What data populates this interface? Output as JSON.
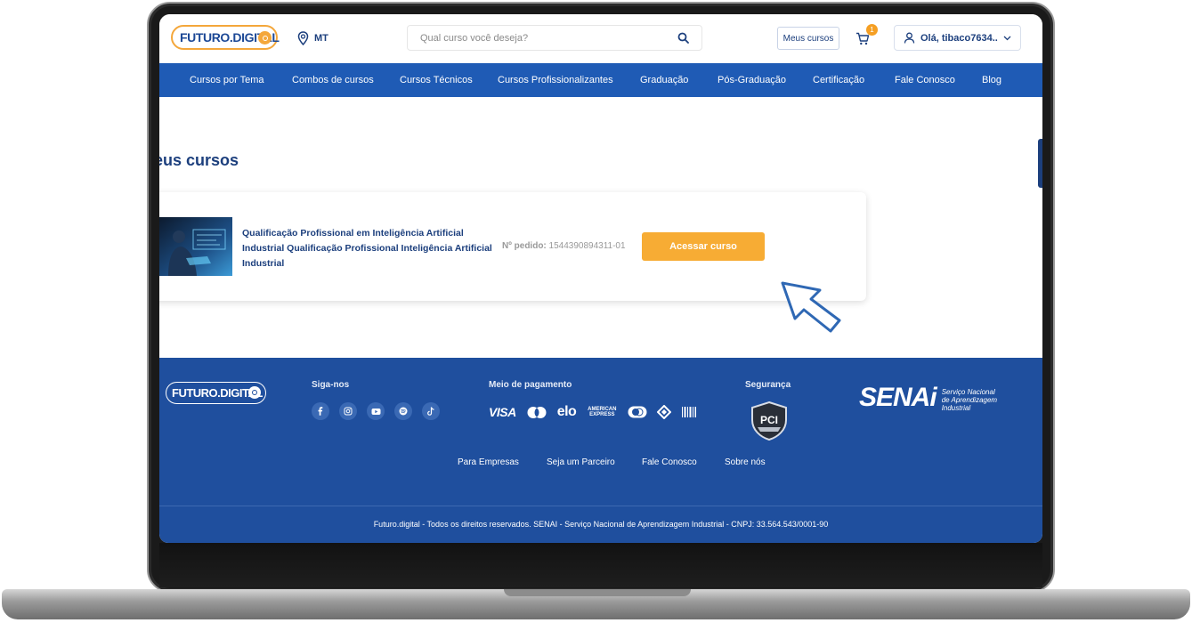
{
  "header": {
    "logo": "FUTURO.DIGITAL",
    "location": "MT",
    "search_placeholder": "Qual curso você deseja?",
    "my_courses_button": "Meus cursos",
    "cart_count": "1",
    "user_greeting": "Olá, tibaco7634..."
  },
  "nav": {
    "items": [
      "Cursos por Tema",
      "Combos de cursos",
      "Cursos Técnicos",
      "Cursos Profissionalizantes",
      "Graduação",
      "Pós-Graduação",
      "Certificação",
      "Fale Conosco",
      "Blog"
    ]
  },
  "main": {
    "title": "eus cursos",
    "course": {
      "name": "Qualificação Profissional em Inteligência Artificial Industrial Qualificação Profissional Inteligência Artificial Industrial",
      "order_label": "Nº pedido:",
      "order_number": "1544390894311-01",
      "access_button": "Acessar curso"
    }
  },
  "footer": {
    "logo": "FUTURO.DIGITAL",
    "follow_heading": "Siga-nos",
    "payment_heading": "Meio de pagamento",
    "security_heading": "Segurança",
    "payment_brands": [
      "VISA",
      "elo",
      "AMERICAN EXPRESS"
    ],
    "pci_text": "PCI",
    "senai_word": "SENAi",
    "senai_subtitle": "Serviço Nacional de Aprendizagem Industrial",
    "links": [
      "Para Empresas",
      "Seja um Parceiro",
      "Fale Conosco",
      "Sobre nós"
    ],
    "copyright": "Futuro.digital - Todos os direitos reservados. SENAI - Serviço Nacional de Aprendizagem Industrial - CNPJ: 33.564.543/0001-90"
  },
  "colors": {
    "brand_blue": "#1f5bb5",
    "footer_blue": "#1f4f9e",
    "title_navy": "#1c3f7d",
    "accent_orange": "#f7ac34"
  }
}
